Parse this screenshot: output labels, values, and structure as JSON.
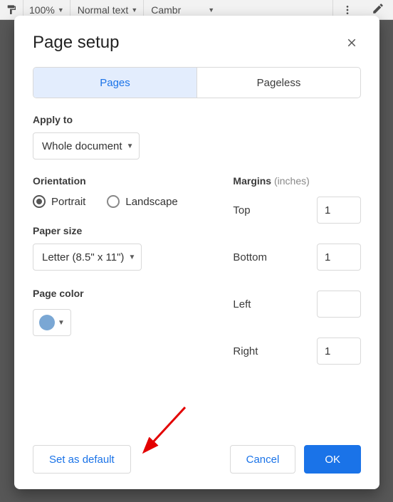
{
  "background_toolbar": {
    "zoom": "100%",
    "style": "Normal text",
    "font": "Cambr"
  },
  "dialog": {
    "title": "Page setup",
    "tabs": {
      "pages": "Pages",
      "pageless": "Pageless"
    },
    "apply_to": {
      "label": "Apply to",
      "value": "Whole document"
    },
    "orientation": {
      "label": "Orientation",
      "options": {
        "portrait": "Portrait",
        "landscape": "Landscape"
      }
    },
    "paper_size": {
      "label": "Paper size",
      "value": "Letter (8.5\" x 11\")"
    },
    "page_color": {
      "label": "Page color",
      "color": "#7aa7d4"
    },
    "margins": {
      "label": "Margins",
      "hint": "(inches)",
      "top_label": "Top",
      "top_value": "1",
      "bottom_label": "Bottom",
      "bottom_value": "1",
      "left_label": "Left",
      "left_value": "",
      "right_label": "Right",
      "right_value": "1"
    },
    "buttons": {
      "set_default": "Set as default",
      "cancel": "Cancel",
      "ok": "OK"
    }
  }
}
